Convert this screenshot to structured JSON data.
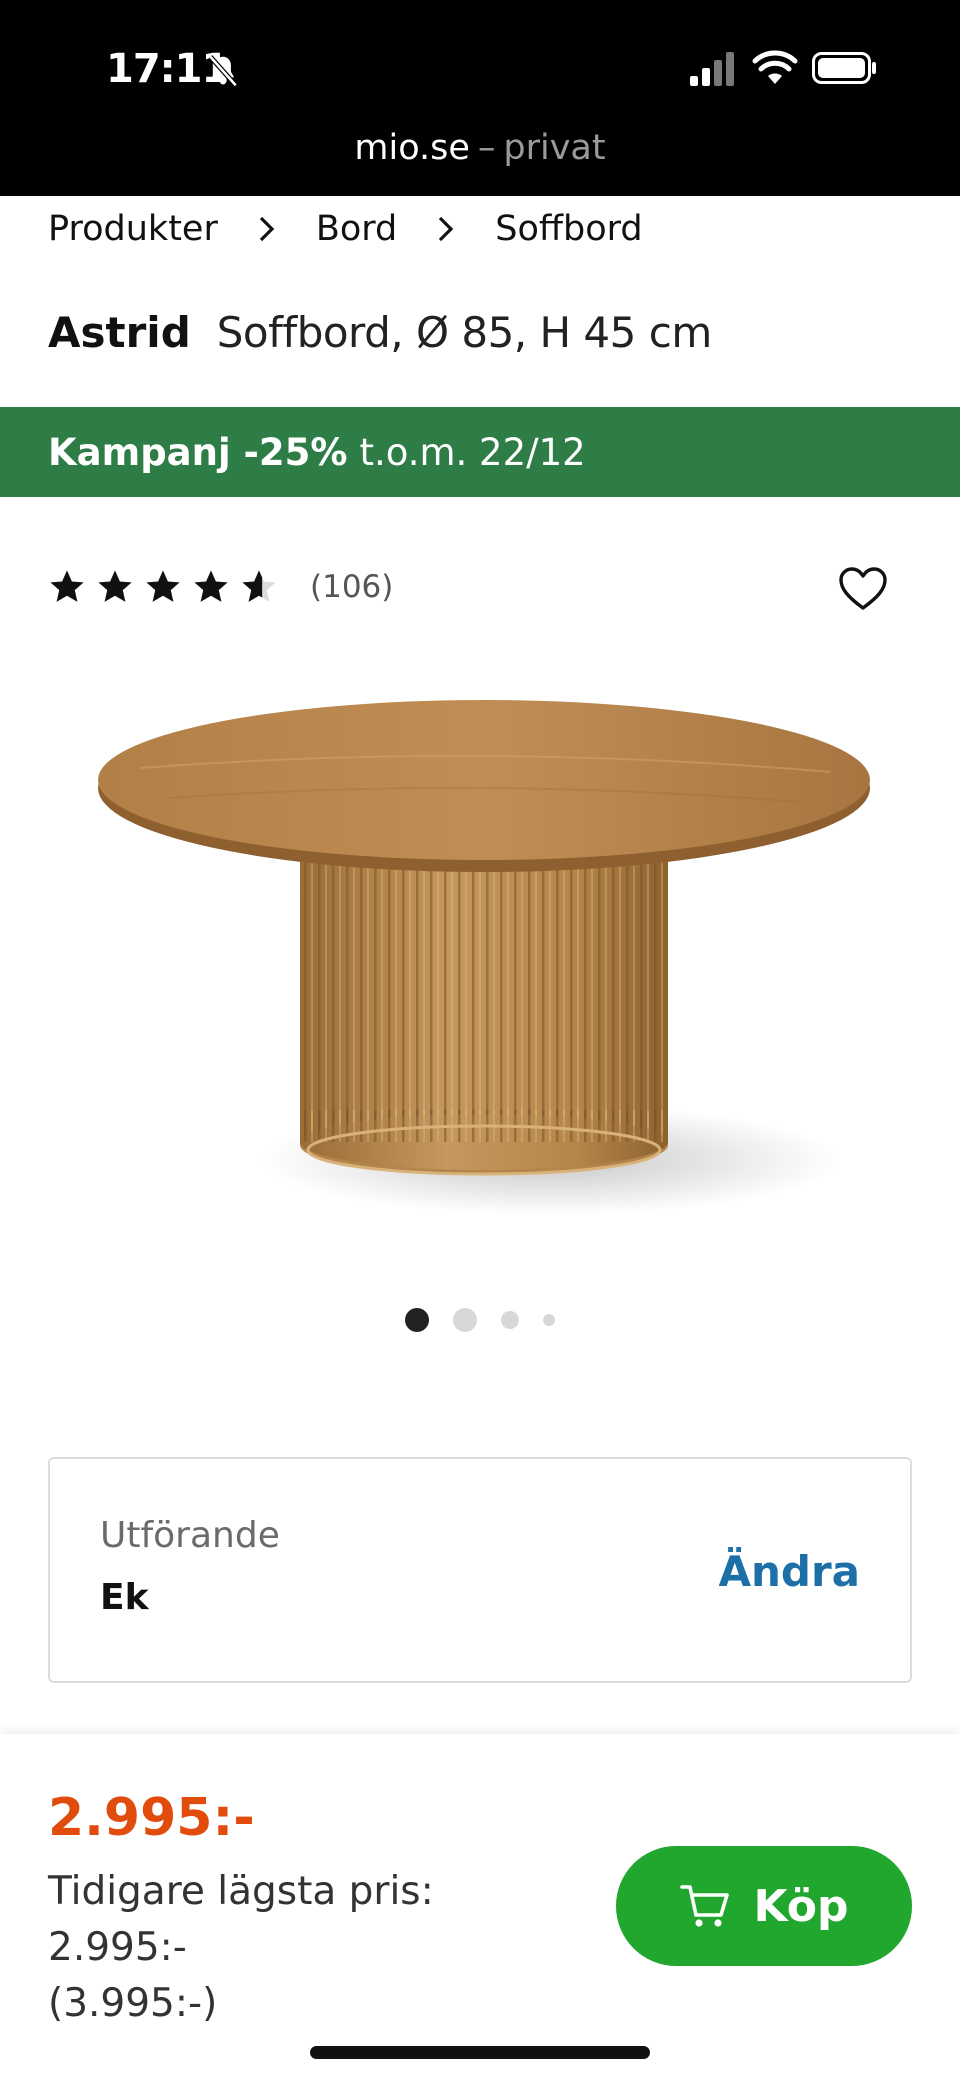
{
  "status_bar": {
    "time": "17:11",
    "url_domain": "mio.se",
    "url_separator": "–",
    "url_mode": "privat"
  },
  "breadcrumb": [
    "Produkter",
    "Bord",
    "Soffbord"
  ],
  "product": {
    "brand": "Astrid",
    "subtitle": "Soffbord, Ø 85, H 45 cm"
  },
  "campaign": {
    "strong": "Kampanj -25%",
    "rest": "t.o.m. 22/12",
    "color": "#2e7d46"
  },
  "rating": {
    "stars": 4.5,
    "max_stars": 5,
    "review_count": "(106)"
  },
  "carousel": {
    "active_index": 0,
    "total": 4
  },
  "variant": {
    "label": "Utförande",
    "value": "Ek",
    "change_label": "Ändra"
  },
  "purchase": {
    "price": "2.995:-",
    "previous_label": "Tidigare lägsta pris:",
    "previous_value": "2.995:-",
    "original_price": "(3.995:-)",
    "buy_label": "Köp",
    "price_color": "#e14b0c",
    "buy_color": "#21a62e"
  },
  "icons": {
    "breadcrumb_separator": "chevron-right-icon",
    "favorite": "heart-icon",
    "cart": "cart-icon"
  }
}
